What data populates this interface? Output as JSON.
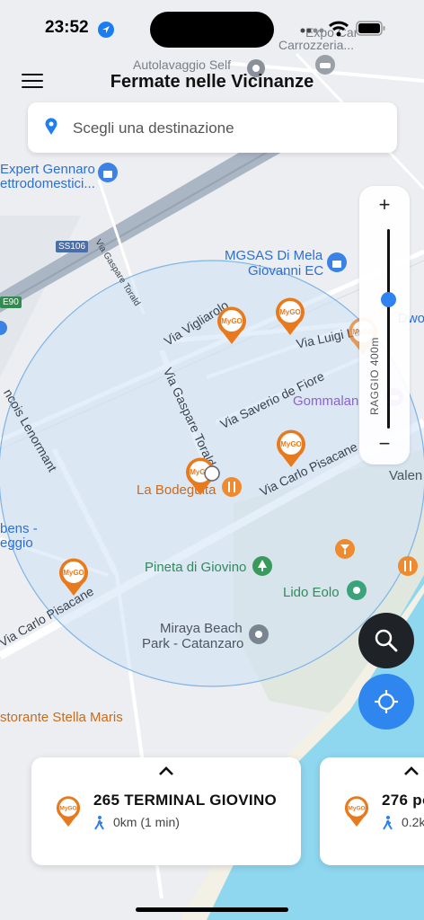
{
  "status_bar": {
    "time": "23:52"
  },
  "header": {
    "title": "Fermate nelle Vicinanze"
  },
  "search": {
    "placeholder": "Scegli una destinazione"
  },
  "radius": {
    "plus": "+",
    "minus": "−",
    "label": "RAGGIO 400m",
    "level": 0.65
  },
  "map": {
    "pois": [
      {
        "text": "Autolavaggio Self",
        "style": "gray"
      },
      {
        "text": "Expo Car",
        "style": "gray"
      },
      {
        "text": "Carrozzeria...",
        "style": "gray"
      },
      {
        "text": "Expert Gennaro",
        "style": "blue"
      },
      {
        "text": "ettrodomestici...",
        "style": "blue"
      },
      {
        "text": "MGSAS Di Mela",
        "style": "blue"
      },
      {
        "text": "Giovanni EC",
        "style": "blue"
      },
      {
        "text": "Dwo",
        "style": "blue"
      },
      {
        "text": "Gommalan",
        "style": "purple"
      },
      {
        "text": "Valen",
        "style": "dark"
      },
      {
        "text": "La Bodeguita",
        "style": "orange"
      },
      {
        "text": "Pineta di Giovino",
        "style": "green"
      },
      {
        "text": "Lido Eolo",
        "style": "green"
      },
      {
        "text": "Miraya Beach",
        "style": "dark"
      },
      {
        "text": "Park - Catanzaro",
        "style": "dark"
      },
      {
        "text": "storante Stella Maris",
        "style": "orange"
      },
      {
        "text": "bens -",
        "style": "blue"
      },
      {
        "text": "eggio",
        "style": "blue"
      }
    ],
    "streets": [
      "SS106",
      "Via Gaspare Torald",
      "Via Vigliarolo",
      "Via Luigi La",
      "Via Saverio de Fiore",
      "Via Gaspare Toraldo",
      "Via Carlo Pisacane",
      "Via Carlo Pisacane",
      "ncois Lenormant",
      "E90"
    ]
  },
  "actions": {
    "search_icon": "magnifier-icon",
    "locate_icon": "crosshair-icon"
  },
  "stops": [
    {
      "name": "265 TERMINAL GIOVINO",
      "distance": "0km (1 min)"
    },
    {
      "name": "276 po",
      "distance": "0.2k"
    }
  ],
  "colors": {
    "accent": "#2f86ef",
    "stop_orange": "#e87a1e",
    "radius_fill": "#d4e6f7",
    "sea": "#8fd6ef"
  }
}
